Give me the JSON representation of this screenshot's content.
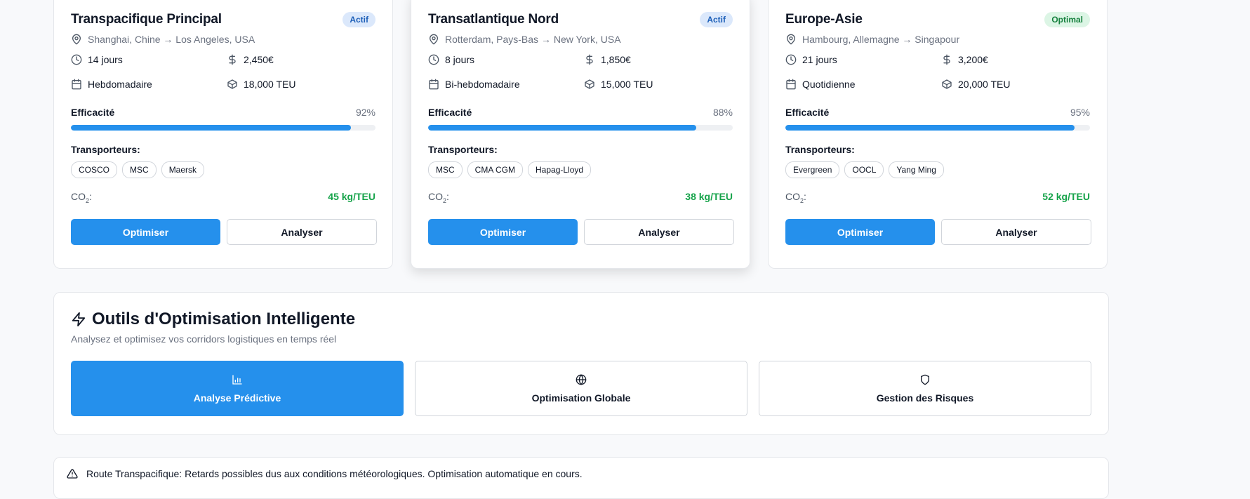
{
  "corridors": [
    {
      "title": "Transpacifique Principal",
      "status": "Actif",
      "route": "Shanghai, Chine → Los Angeles, USA",
      "duration": "14 jours",
      "cost": "2,450€",
      "frequency": "Hebdomadaire",
      "capacity": "18,000 TEU",
      "efficiency_label": "Efficacité",
      "efficiency": "92%",
      "efficiency_value": 92,
      "carriers_label": "Transporteurs:",
      "carriers": [
        "COSCO",
        "MSC",
        "Maersk"
      ],
      "co2_label": "CO₂:",
      "co2": "45 kg/TEU",
      "optimize_label": "Optimiser",
      "analyze_label": "Analyser"
    },
    {
      "title": "Transatlantique Nord",
      "status": "Actif",
      "route": "Rotterdam, Pays-Bas → New York, USA",
      "duration": "8 jours",
      "cost": "1,850€",
      "frequency": "Bi-hebdomadaire",
      "capacity": "15,000 TEU",
      "efficiency_label": "Efficacité",
      "efficiency": "88%",
      "efficiency_value": 88,
      "carriers_label": "Transporteurs:",
      "carriers": [
        "MSC",
        "CMA CGM",
        "Hapag-Lloyd"
      ],
      "co2_label": "CO₂:",
      "co2": "38 kg/TEU",
      "optimize_label": "Optimiser",
      "analyze_label": "Analyser"
    },
    {
      "title": "Europe-Asie",
      "status": "Optimal",
      "route": "Hambourg, Allemagne → Singapour",
      "duration": "21 jours",
      "cost": "3,200€",
      "frequency": "Quotidienne",
      "capacity": "20,000 TEU",
      "efficiency_label": "Efficacité",
      "efficiency": "95%",
      "efficiency_value": 95,
      "carriers_label": "Transporteurs:",
      "carriers": [
        "Evergreen",
        "OOCL",
        "Yang Ming"
      ],
      "co2_label": "CO₂:",
      "co2": "52 kg/TEU",
      "optimize_label": "Optimiser",
      "analyze_label": "Analyser"
    }
  ],
  "tools": {
    "title": "Outils d'Optimisation Intelligente",
    "subtitle": "Analysez et optimisez vos corridors logistiques en temps réel",
    "items": [
      {
        "label": "Analyse Prédictive",
        "icon": "bar-chart-icon",
        "active": true
      },
      {
        "label": "Optimisation Globale",
        "icon": "globe-icon",
        "active": false
      },
      {
        "label": "Gestion des Risques",
        "icon": "shield-icon",
        "active": false
      }
    ]
  },
  "alert": {
    "icon": "warning-triangle-icon",
    "text": "Route Transpacifique: Retards possibles dus aux conditions météorologiques. Optimisation automatique en cours."
  },
  "colors": {
    "accent": "#2590ec",
    "success": "#16a34a",
    "badge_active_bg": "#dbe8fb",
    "badge_optimal_bg": "#dcf5e5"
  }
}
